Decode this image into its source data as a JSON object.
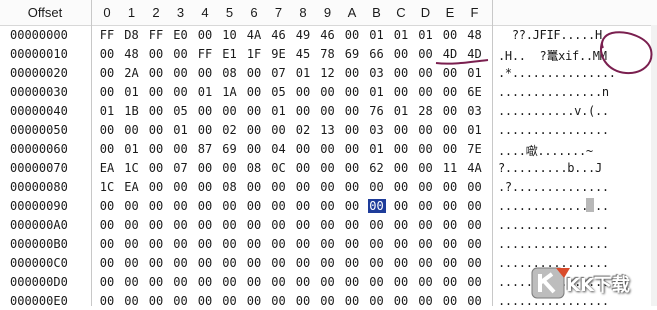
{
  "header": {
    "offset_label": "Offset",
    "columns": [
      "0",
      "1",
      "2",
      "3",
      "4",
      "5",
      "6",
      "7",
      "8",
      "9",
      "A",
      "B",
      "C",
      "D",
      "E",
      "F"
    ]
  },
  "rows": [
    {
      "offset": "00000000",
      "bytes": [
        "FF",
        "D8",
        "FF",
        "E0",
        "00",
        "10",
        "4A",
        "46",
        "49",
        "46",
        "00",
        "01",
        "01",
        "01",
        "00",
        "48"
      ],
      "ascii": "  ??.JFIF.....H"
    },
    {
      "offset": "00000010",
      "bytes": [
        "00",
        "48",
        "00",
        "00",
        "FF",
        "E1",
        "1F",
        "9E",
        "45",
        "78",
        "69",
        "66",
        "00",
        "00",
        "4D",
        "4D"
      ],
      "ascii": ".H..  ?鼍xif..MM"
    },
    {
      "offset": "00000020",
      "bytes": [
        "00",
        "2A",
        "00",
        "00",
        "00",
        "08",
        "00",
        "07",
        "01",
        "12",
        "00",
        "03",
        "00",
        "00",
        "00",
        "01"
      ],
      "ascii": ".*..............."
    },
    {
      "offset": "00000030",
      "bytes": [
        "00",
        "01",
        "00",
        "00",
        "01",
        "1A",
        "00",
        "05",
        "00",
        "00",
        "00",
        "01",
        "00",
        "00",
        "00",
        "6E"
      ],
      "ascii": "...............n"
    },
    {
      "offset": "00000040",
      "bytes": [
        "01",
        "1B",
        "00",
        "05",
        "00",
        "00",
        "00",
        "01",
        "00",
        "00",
        "00",
        "76",
        "01",
        "28",
        "00",
        "03"
      ],
      "ascii": "...........v.(.."
    },
    {
      "offset": "00000050",
      "bytes": [
        "00",
        "00",
        "00",
        "01",
        "00",
        "02",
        "00",
        "00",
        "02",
        "13",
        "00",
        "03",
        "00",
        "00",
        "00",
        "01"
      ],
      "ascii": "................"
    },
    {
      "offset": "00000060",
      "bytes": [
        "00",
        "01",
        "00",
        "00",
        "87",
        "69",
        "00",
        "04",
        "00",
        "00",
        "00",
        "01",
        "00",
        "00",
        "00",
        "7E"
      ],
      "ascii": "....噷.......~"
    },
    {
      "offset": "00000070",
      "bytes": [
        "EA",
        "1C",
        "00",
        "07",
        "00",
        "00",
        "08",
        "0C",
        "00",
        "00",
        "00",
        "62",
        "00",
        "00",
        "11",
        "4A"
      ],
      "ascii": "?.........b...J"
    },
    {
      "offset": "00000080",
      "bytes": [
        "1C",
        "EA",
        "00",
        "00",
        "00",
        "08",
        "00",
        "00",
        "00",
        "00",
        "00",
        "00",
        "00",
        "00",
        "00",
        "00"
      ],
      "ascii": ".?.............."
    },
    {
      "offset": "00000090",
      "bytes": [
        "00",
        "00",
        "00",
        "00",
        "00",
        "00",
        "00",
        "00",
        "00",
        "00",
        "00",
        "00",
        "00",
        "00",
        "00",
        "00"
      ],
      "ascii": "................"
    },
    {
      "offset": "000000A0",
      "bytes": [
        "00",
        "00",
        "00",
        "00",
        "00",
        "00",
        "00",
        "00",
        "00",
        "00",
        "00",
        "00",
        "00",
        "00",
        "00",
        "00"
      ],
      "ascii": "................"
    },
    {
      "offset": "000000B0",
      "bytes": [
        "00",
        "00",
        "00",
        "00",
        "00",
        "00",
        "00",
        "00",
        "00",
        "00",
        "00",
        "00",
        "00",
        "00",
        "00",
        "00"
      ],
      "ascii": "................"
    },
    {
      "offset": "000000C0",
      "bytes": [
        "00",
        "00",
        "00",
        "00",
        "00",
        "00",
        "00",
        "00",
        "00",
        "00",
        "00",
        "00",
        "00",
        "00",
        "00",
        "00"
      ],
      "ascii": "................"
    },
    {
      "offset": "000000D0",
      "bytes": [
        "00",
        "00",
        "00",
        "00",
        "00",
        "00",
        "00",
        "00",
        "00",
        "00",
        "00",
        "00",
        "00",
        "00",
        "00",
        "00"
      ],
      "ascii": "................"
    },
    {
      "offset": "000000E0",
      "bytes": [
        "00",
        "00",
        "00",
        "00",
        "00",
        "00",
        "00",
        "00",
        "00",
        "00",
        "00",
        "00",
        "00",
        "00",
        "00",
        "00"
      ],
      "ascii": "................"
    }
  ],
  "selection": {
    "row": 9,
    "col": 11
  },
  "annotation_color": "#7a1f4f",
  "watermark": {
    "text": "KK下载"
  }
}
